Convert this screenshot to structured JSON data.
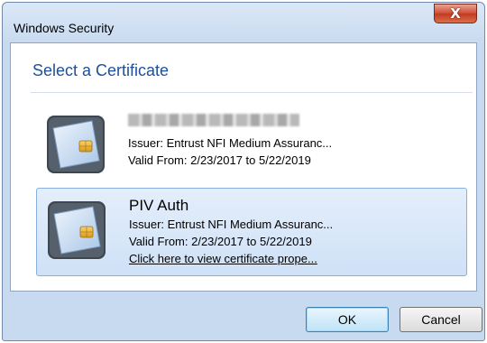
{
  "window": {
    "title": "Windows Security",
    "close_glyph": "X"
  },
  "dialog": {
    "heading": "Select a Certificate"
  },
  "certificates": [
    {
      "name": "",
      "name_redacted": true,
      "issuer": "Issuer: Entrust NFI Medium Assuranc...",
      "valid": "Valid From: 2/23/2017 to 5/22/2019",
      "selected": false,
      "icon": "smart-card-icon"
    },
    {
      "name": "PIV Auth",
      "name_redacted": false,
      "issuer": "Issuer: Entrust NFI Medium Assuranc...",
      "valid": "Valid From: 2/23/2017 to 5/22/2019",
      "link": "Click here to view certificate prope...",
      "selected": true,
      "icon": "smart-card-icon"
    }
  ],
  "buttons": {
    "ok": "OK",
    "cancel": "Cancel"
  },
  "colors": {
    "heading": "#1e4f9a",
    "selection": "#cfe1f7",
    "close": "#c3391e"
  }
}
